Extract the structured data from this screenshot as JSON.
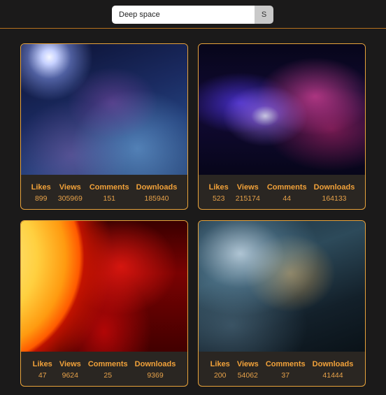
{
  "search": {
    "value": "Deep space",
    "button_label": "S"
  },
  "stat_labels": {
    "likes": "Likes",
    "views": "Views",
    "comments": "Comments",
    "downloads": "Downloads"
  },
  "cards": [
    {
      "image": "galaxy-stars-image",
      "likes": "899",
      "views": "305969",
      "comments": "151",
      "downloads": "185940"
    },
    {
      "image": "purple-nebula-image",
      "likes": "523",
      "views": "215174",
      "comments": "44",
      "downloads": "164133"
    },
    {
      "image": "red-sun-image",
      "likes": "47",
      "views": "9624",
      "comments": "25",
      "downloads": "9369"
    },
    {
      "image": "spaceship-image",
      "likes": "200",
      "views": "54062",
      "comments": "37",
      "downloads": "41444"
    }
  ],
  "colors": {
    "accent": "#e8a33b",
    "background": "#1b1a1a",
    "stat_text": "#f2a23a"
  }
}
